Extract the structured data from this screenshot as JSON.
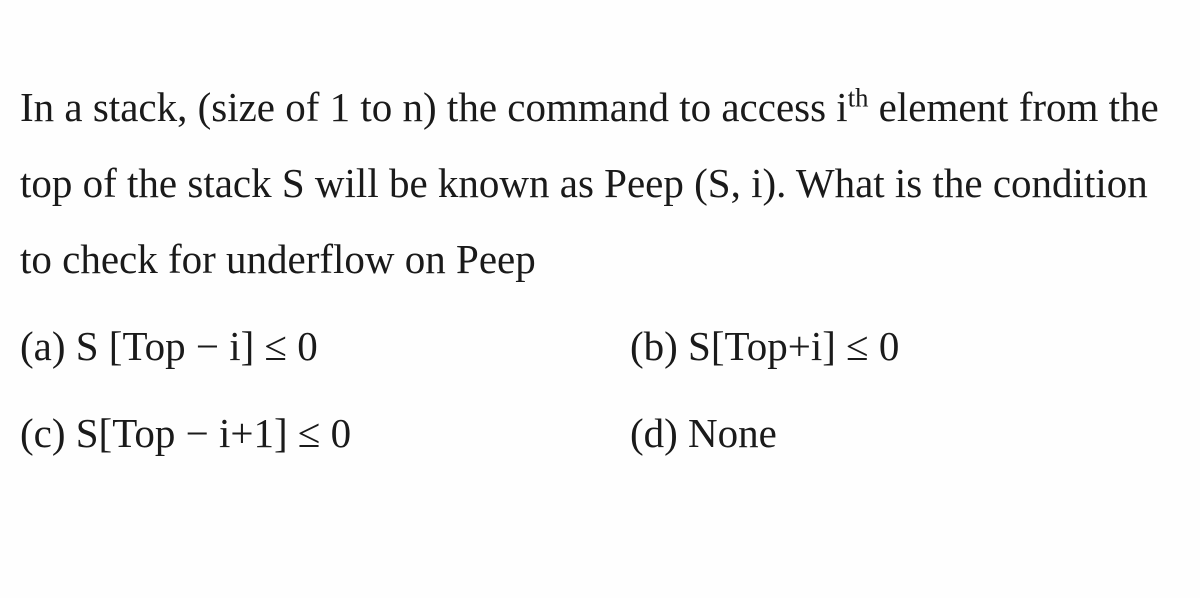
{
  "question": {
    "part1": "In a stack, (size of 1 to n) the command to access i",
    "superscript": "th",
    "part2": " element from the top of the stack S will be known as Peep (S, i). What is the condition to check for underflow on Peep"
  },
  "options": {
    "a": "(a) S [Top − i] ≤ 0",
    "b": "(b) S[Top+i] ≤ 0",
    "c": "(c) S[Top − i+1] ≤ 0",
    "d": "(d) None"
  }
}
